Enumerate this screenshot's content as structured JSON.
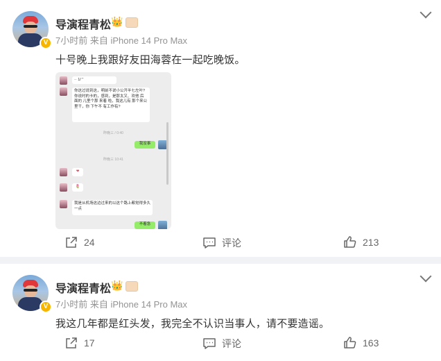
{
  "posts": [
    {
      "author": "导演程青松",
      "meta": "7小时前  来自 iPhone 14 Pro Max",
      "text": "十号晚上我跟好友田海蓉在一起吃晚饭。",
      "actions": {
        "repost": "24",
        "comment": "评论",
        "like": "213"
      },
      "chat_screenshot": {
        "top_msg": "·· 1/ ''",
        "msg1": "你这过说到这，明前不说小公开半七左叶? 你说时的卡的，感到，是那太又、欢他 后面的 儿里个那 来着 啦，我这儿有 那个来公里干，你 下午不 有工作有?",
        "time1": "昨晚三 / 0:40",
        "reply1": "我没事",
        "time2": "昨晚三 10:41",
        "emoji1": "❤",
        "emoji2": "🌷",
        "msg2": "我是从机场这边过来的以这个路上都觉得多久一点",
        "reply2": "不着急"
      }
    },
    {
      "author": "导演程青松",
      "meta": "7小时前  来自 iPhone 14 Pro Max",
      "text": "我这几年都是红头发，我完全不认识当事人，请不要造谣。",
      "actions": {
        "repost": "17",
        "comment": "评论",
        "like": "163"
      }
    }
  ],
  "colors": {
    "verified": "#f7b500",
    "chat_green": "#95ec69",
    "page_bg": "#f1f2f5"
  },
  "icons": [
    "chevron-down-icon",
    "verified-icon",
    "crown-badge-icon",
    "repost-icon",
    "comment-icon",
    "like-icon"
  ]
}
